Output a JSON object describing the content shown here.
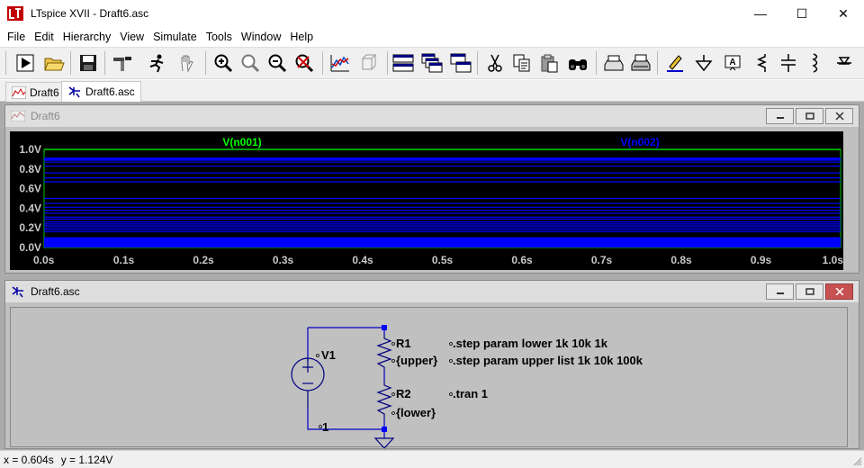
{
  "window": {
    "title": "LTspice XVII - Draft6.asc",
    "minimize_glyph": "—",
    "maximize_glyph": "☐",
    "close_glyph": "✕"
  },
  "menu": [
    "File",
    "Edit",
    "Hierarchy",
    "View",
    "Simulate",
    "Tools",
    "Window",
    "Help"
  ],
  "toolbar": {
    "icons": [
      "run-icon",
      "open-icon",
      "save-icon",
      "control-panel-icon",
      "halt-icon",
      "pan-icon",
      "zoom-in-icon",
      "zoom-fit-icon",
      "zoom-out-icon",
      "zoom-cancel-icon",
      "autorange-icon",
      "3d-icon",
      "tile-horizontal-icon",
      "cascade-icon",
      "tile-vertical-icon",
      "cut-icon",
      "copy-icon",
      "paste-icon",
      "find-icon",
      "print-setup-icon",
      "print-icon",
      "label-net-icon",
      "ground-icon",
      "label-icon",
      "resistor-icon",
      "capacitor-icon",
      "inductor-icon",
      "diode-icon"
    ]
  },
  "tabs": [
    {
      "label": "Draft6",
      "icon": "waveform-icon"
    },
    {
      "label": "Draft6.asc",
      "icon": "schematic-icon"
    }
  ],
  "waveform_window": {
    "title": "Draft6",
    "colors": {
      "plot_bg": "#000000",
      "grid": "#2b2b2b",
      "frame": "#00c800",
      "trace_a": "#00ff00",
      "trace_b": "#0000ff",
      "tick_text": "#c8c8c8"
    }
  },
  "chart_data": {
    "type": "line",
    "title": "",
    "xlabel": "",
    "ylabel": "",
    "xlim": [
      0,
      1.0
    ],
    "ylim": [
      0,
      1.0
    ],
    "grid": false,
    "x_ticks": [
      "0.0s",
      "0.1s",
      "0.2s",
      "0.3s",
      "0.4s",
      "0.5s",
      "0.6s",
      "0.7s",
      "0.8s",
      "0.9s",
      "1.0s"
    ],
    "x_tick_values": [
      0.0,
      0.1,
      0.2,
      0.3,
      0.4,
      0.5,
      0.6,
      0.7,
      0.8,
      0.9,
      1.0
    ],
    "y_ticks": [
      "1.0V",
      "0.8V",
      "0.6V",
      "0.4V",
      "0.2V",
      "0.0V"
    ],
    "y_tick_values": [
      1.0,
      0.8,
      0.6,
      0.4,
      0.2,
      0.0
    ],
    "series": [
      {
        "name": "V(n001)",
        "color": "#00ff00",
        "values": [
          1.0
        ]
      },
      {
        "name": "V(n002)",
        "color": "#0000ff",
        "values": [
          0.91,
          0.909,
          0.9,
          0.89,
          0.87,
          0.83,
          0.76,
          0.71,
          0.67,
          0.5,
          0.45,
          0.41,
          0.38,
          0.35,
          0.31,
          0.29,
          0.26,
          0.24,
          0.22,
          0.2,
          0.18,
          0.16,
          0.1,
          0.09,
          0.08,
          0.07,
          0.06,
          0.05
        ]
      }
    ]
  },
  "schematic_window": {
    "title": "Draft6.asc",
    "source_name": "V1",
    "source_value": "1",
    "r1_name": "R1",
    "r1_value": "{upper}",
    "r2_name": "R2",
    "r2_value": "{lower}",
    "directives": [
      ".step param lower 1k 10k 1k",
      ".step param upper list 1k 10k 100k",
      ".tran 1"
    ],
    "colors": {
      "wire": "#0000c8",
      "component": "#000080",
      "junction": "#0000ff",
      "text": "#000000"
    }
  },
  "status": {
    "x_readout": "x = 0.604s",
    "y_readout": "y = 1.124V"
  }
}
